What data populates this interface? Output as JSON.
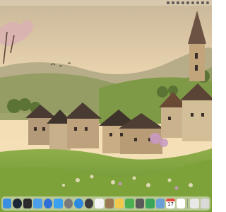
{
  "desktop": {
    "wallpaper": "village-landscape"
  },
  "menubar": {
    "status_icons": [
      "app-icon",
      "dropbox-icon",
      "screen-icon",
      "headphones-icon",
      "battery-icon",
      "wifi-icon",
      "search-icon",
      "control-center-icon",
      "avatar-icon"
    ]
  },
  "dock": {
    "apps": [
      {
        "name": "finder",
        "icon": "finder-icon",
        "color": "#3b8fe0"
      },
      {
        "name": "steam",
        "icon": "steam-icon",
        "color": "#1b2838"
      },
      {
        "name": "terminal",
        "icon": "terminal-icon",
        "color": "#2b2b2b"
      },
      {
        "name": "mail",
        "icon": "mail-icon",
        "color": "#4a9fe8"
      },
      {
        "name": "browser",
        "icon": "browser-icon",
        "color": "#2f6fd8"
      },
      {
        "name": "app-store",
        "icon": "app-store-icon",
        "color": "#3aa0f0"
      },
      {
        "name": "settings",
        "icon": "gear-icon",
        "color": "#7a7a7a"
      },
      {
        "name": "safari",
        "icon": "compass-icon",
        "color": "#2b8ae0"
      },
      {
        "name": "chatgpt",
        "icon": "chatgpt-icon",
        "color": "#3b3b3b"
      },
      {
        "name": "photos",
        "icon": "photo-icon",
        "color": "#f4f4f4"
      },
      {
        "name": "preview",
        "icon": "preview-icon",
        "color": "#9a7a55"
      },
      {
        "name": "notes",
        "icon": "notes-icon",
        "color": "#f3c94b"
      },
      {
        "name": "maps",
        "icon": "map-icon",
        "color": "#4caf50"
      },
      {
        "name": "calculator",
        "icon": "calculator-icon",
        "color": "#5a5a5a"
      },
      {
        "name": "numbers",
        "icon": "numbers-icon",
        "color": "#3aa55a"
      },
      {
        "name": "finder-folder",
        "icon": "folder-icon",
        "color": "#6a9fd8"
      },
      {
        "name": "notion",
        "icon": "notion-icon",
        "color": "#ffffff"
      }
    ],
    "calendar": {
      "month": "",
      "day": "17"
    },
    "extra": [
      {
        "name": "screenshot",
        "icon": "screenshot-icon",
        "color": "#e8e8e8"
      },
      {
        "name": "trash",
        "icon": "trash-icon",
        "color": "#d9d9d9"
      }
    ]
  }
}
